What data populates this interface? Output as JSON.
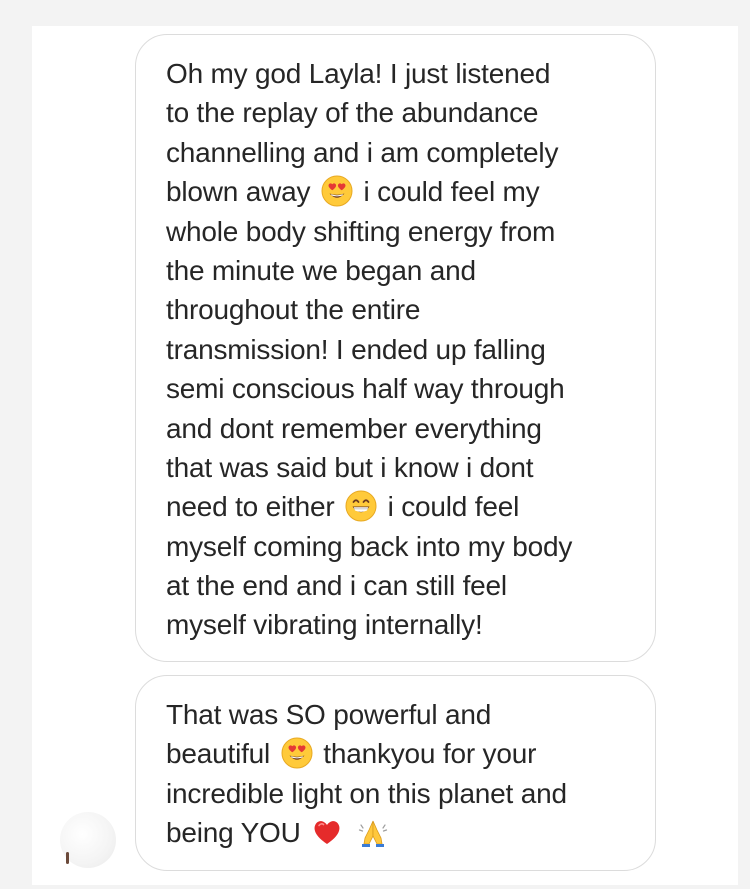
{
  "conversation": {
    "messages": [
      {
        "lines": [
          "Oh my god Layla! I just listened",
          "to the replay of the abundance",
          "channelling and i am completely",
          [
            "blown away",
            "heart-eyes-emoji",
            "i could feel my"
          ],
          "whole body shifting energy from",
          "the minute we began and",
          "throughout the entire",
          "transmission! I ended up falling",
          "semi conscious half way through",
          "and dont remember everything",
          "that was said but i know i dont",
          [
            "need to either",
            "grinning-emoji",
            "i could feel"
          ],
          "myself coming back into my body",
          "at the end and i can still feel",
          "myself vibrating internally!"
        ]
      },
      {
        "lines": [
          "That was SO powerful and",
          [
            "beautiful",
            "heart-eyes-emoji",
            "thankyou for your"
          ],
          "incredible light on this planet and",
          [
            "being YOU",
            "red-heart-emoji",
            "folded-hands-emoji"
          ]
        ]
      }
    ]
  },
  "colors": {
    "bubble_border": "#dcdcdc",
    "text": "#262626",
    "background": "#ffffff",
    "outer_background": "#f3f3f3"
  }
}
